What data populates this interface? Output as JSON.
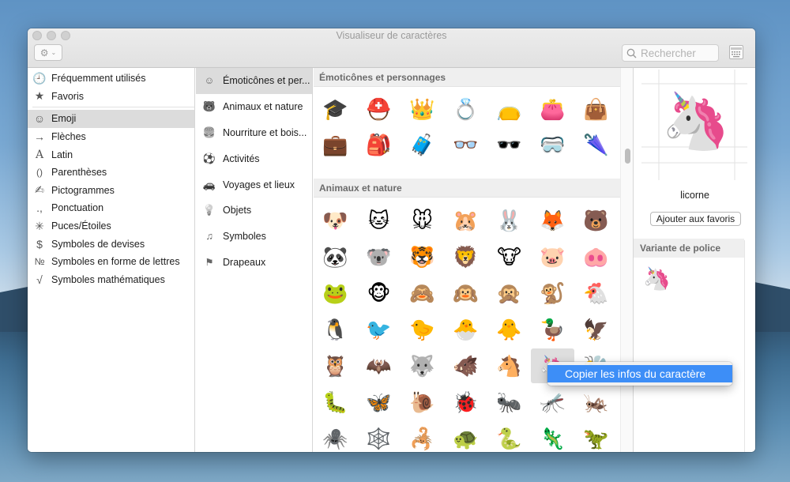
{
  "window": {
    "title": "Visualiseur de caractères"
  },
  "toolbar": {
    "gear_icon": "gear-icon",
    "search_placeholder": "Rechercher"
  },
  "categories": [
    {
      "label": "Fréquemment utilisés",
      "icon": "🕘"
    },
    {
      "label": "Favoris",
      "icon": "★"
    },
    {
      "label": "Emoji",
      "icon": "☺",
      "selected": true
    },
    {
      "label": "Flèches",
      "icon": "→"
    },
    {
      "label": "Latin",
      "icon": "A"
    },
    {
      "label": "Parenthèses",
      "icon": "()"
    },
    {
      "label": "Pictogrammes",
      "icon": "✍"
    },
    {
      "label": "Ponctuation",
      "icon": ".,"
    },
    {
      "label": "Puces/Étoiles",
      "icon": "✳"
    },
    {
      "label": "Symboles de devises",
      "icon": "$"
    },
    {
      "label": "Symboles en forme de lettres",
      "icon": "№"
    },
    {
      "label": "Symboles mathématiques",
      "icon": "√"
    }
  ],
  "subcategories": [
    {
      "label": "Émoticônes et per...",
      "icon": "☺",
      "selected": true
    },
    {
      "label": "Animaux et nature",
      "icon": "🐻"
    },
    {
      "label": "Nourriture et bois...",
      "icon": "🍔"
    },
    {
      "label": "Activités",
      "icon": "⚽"
    },
    {
      "label": "Voyages et lieux",
      "icon": "🚗"
    },
    {
      "label": "Objets",
      "icon": "💡"
    },
    {
      "label": "Symboles",
      "icon": "♫"
    },
    {
      "label": "Drapeaux",
      "icon": "⚑"
    }
  ],
  "sections": [
    {
      "title": "Émoticônes et personnages",
      "rows": [
        [
          "🎓",
          "⛑️",
          "👑",
          "💍",
          "👝",
          "👛",
          "👜"
        ],
        [
          "💼",
          "🎒",
          "🧳",
          "👓",
          "🕶️",
          "🥽",
          "🌂"
        ]
      ]
    },
    {
      "title": "Animaux et nature",
      "rows": [
        [
          "🐶",
          "🐱",
          "🐭",
          "🐹",
          "🐰",
          "🦊",
          "🐻"
        ],
        [
          "🐼",
          "🐨",
          "🐯",
          "🦁",
          "🐮",
          "🐷",
          "🐽"
        ],
        [
          "🐸",
          "🐵",
          "🙈",
          "🙉",
          "🙊",
          "🐒",
          "🐔"
        ],
        [
          "🐧",
          "🐦",
          "🐤",
          "🐣",
          "🐥",
          "🦆",
          "🦅"
        ],
        [
          "🦉",
          "🦇",
          "🐺",
          "🐗",
          "🐴",
          "🦄",
          "🐝"
        ],
        [
          "🐛",
          "🦋",
          "🐌",
          "🐞",
          "🐜",
          "🦟",
          "🦗"
        ],
        [
          "🕷️",
          "🕸️",
          "🦂",
          "🐢",
          "🐍",
          "🦎",
          "🦖"
        ]
      ]
    }
  ],
  "detail": {
    "preview": "🦄",
    "name": "licorne",
    "fav_button": "Ajouter aux favoris",
    "variant_header": "Variante de police",
    "variant": "🦄"
  },
  "context_menu": {
    "item": "Copier les infos du caractère"
  }
}
